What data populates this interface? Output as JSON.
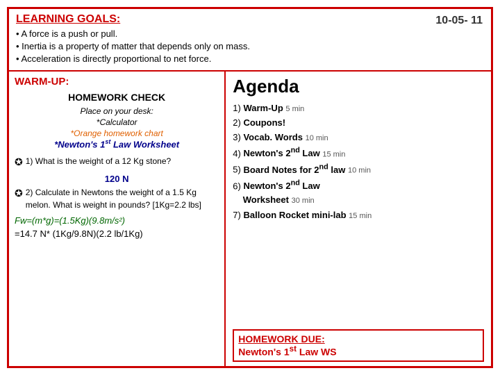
{
  "header": {
    "learning_goals_title": "LEARNING GOALS:",
    "bullets": [
      "A force is a push or pull.",
      "Inertia is a property of matter that depends only on mass.",
      "Acceleration is directly proportional to net force."
    ],
    "date": "10-05- 11"
  },
  "left": {
    "warm_up_label": "WARM-UP:",
    "homework_check_title": "HOMEWORK CHECK",
    "homework_check_line1": "Place on your desk:",
    "homework_check_line2": "*Calculator",
    "homework_check_line3": "*Orange homework chart",
    "homework_check_line4_pre": "*Newton's 1",
    "homework_check_line4_sup": "st",
    "homework_check_line4_post": " Law Worksheet",
    "question1_pre": "1) What is the weight of a 12 Kg stone?",
    "question1_answer": "120 N",
    "question2_pre": "2) Calculate in Newtons the weight of a 1.5 Kg melon. What is weight in pounds? [1Kg=2.2 lbs]",
    "formula": "Fw=(m*g)=(1.5Kg)(9.8m/s²)",
    "result": "=14.7 N* (1Kg/9.8N)(2.2 lb/1Kg)"
  },
  "right": {
    "agenda_title": "Agenda",
    "agenda_items": [
      {
        "num": "1)",
        "label": "Warm-Up",
        "extra": "5 min"
      },
      {
        "num": "2)",
        "label": "Coupons!",
        "extra": ""
      },
      {
        "num": "3)",
        "label": "Vocab. Words",
        "extra": "10 min"
      },
      {
        "num": "4)",
        "label": "Newton's 2",
        "sup": "nd",
        "label_after": " Law",
        "extra": "15 min"
      },
      {
        "num": "5)",
        "label": "Board Notes for 2",
        "sup": "nd",
        "label_after": " law",
        "extra": "10 min"
      },
      {
        "num": "6)",
        "label": "Newton's 2",
        "sup": "nd",
        "label_after": " Law Worksheet",
        "extra": "30 min"
      },
      {
        "num": "7)",
        "label": "Balloon Rocket mini-lab",
        "extra": "15 min"
      }
    ],
    "homework_due_title": "HOMEWORK DUE:",
    "homework_due_item_pre": "Newton's 1",
    "homework_due_item_sup": "st",
    "homework_due_item_post": " Law WS"
  }
}
